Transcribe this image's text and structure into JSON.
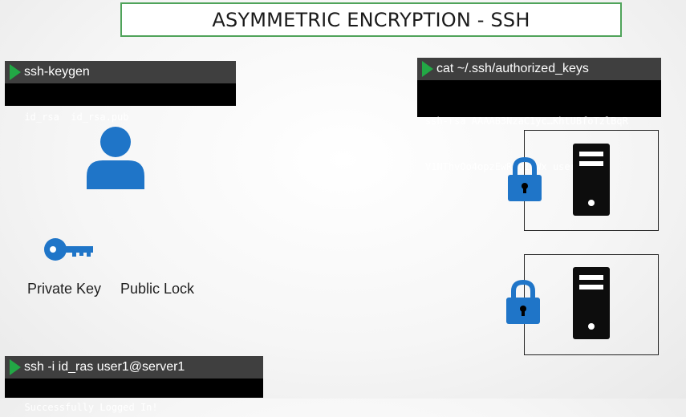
{
  "title": "ASYMMETRIC ENCRYPTION - SSH",
  "keygen_terminal": {
    "command": "ssh-keygen",
    "output": "id_rsa  id_rsa.pub"
  },
  "authorized_keys_terminal": {
    "command": "cat ~/.ssh/authorized_keys",
    "output_line1": "ssh-rsa AAAAB3NzaC1yc…KhtUBfoTzlBqR",
    "output_line2": "V1NThvOo4opzEwRQo1mWx user1"
  },
  "login_terminal": {
    "command": "ssh -i id_ras user1@server1",
    "output": "Successfully Logged In!"
  },
  "labels": {
    "private_key": "Private Key",
    "public_lock": "Public Lock"
  },
  "colors": {
    "accent_blue": "#1f75c8",
    "play_green": "#22a845",
    "title_border": "#4fa35a"
  },
  "icons": {
    "user": "user-icon",
    "key": "key-icon",
    "lock": "lock-icon",
    "server": "server-icon"
  }
}
